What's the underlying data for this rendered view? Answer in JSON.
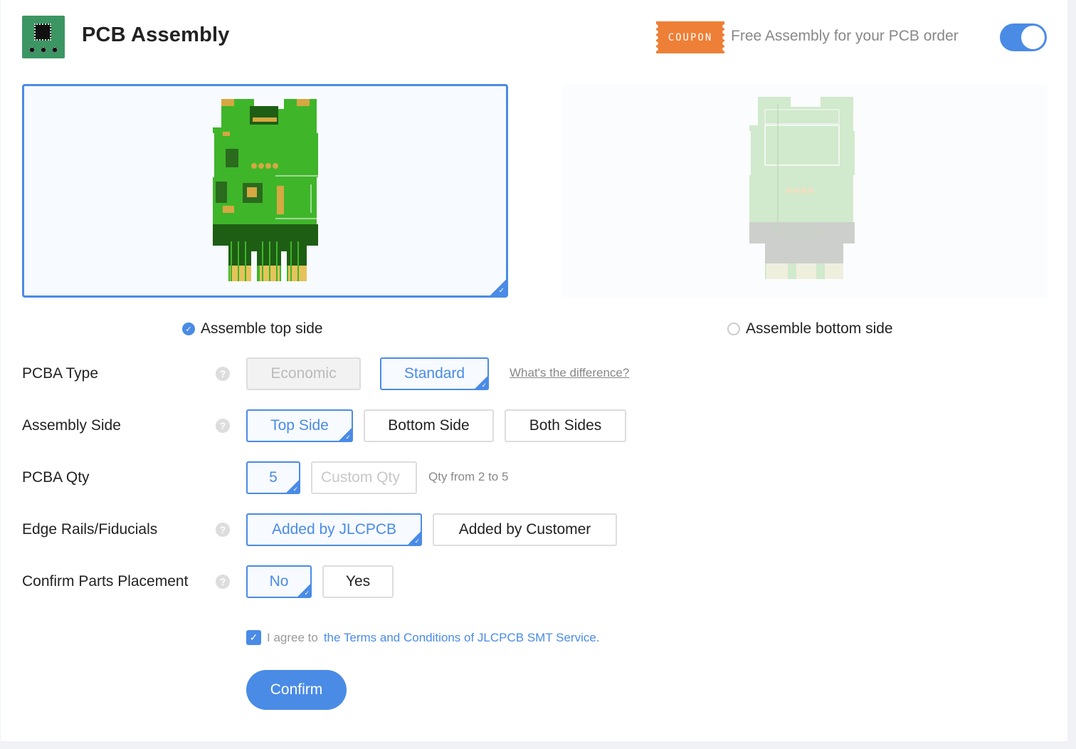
{
  "header": {
    "title": "PCB Assembly",
    "coupon_badge": "coupon",
    "coupon_text": "Free Assembly for your PCB order",
    "free_assembly_toggle_on": true
  },
  "preview": {
    "top_side_label": "Assemble top side",
    "bottom_side_label": "Assemble bottom side",
    "selected": "top"
  },
  "form": {
    "pcba_type": {
      "label": "PCBA Type",
      "options": [
        "Economic",
        "Standard"
      ],
      "selected": "Standard",
      "disabled": [
        "Economic"
      ],
      "link": "What's the difference?"
    },
    "assembly_side": {
      "label": "Assembly Side",
      "options": [
        "Top Side",
        "Bottom Side",
        "Both Sides"
      ],
      "selected": "Top Side"
    },
    "pcba_qty": {
      "label": "PCBA Qty",
      "value": "5",
      "custom_placeholder": "Custom Qty",
      "hint": "Qty from 2 to 5"
    },
    "edge_rails": {
      "label": "Edge Rails/Fiducials",
      "options": [
        "Added by JLCPCB",
        "Added by Customer"
      ],
      "selected": "Added by JLCPCB"
    },
    "confirm_placement": {
      "label": "Confirm Parts Placement",
      "options": [
        "No",
        "Yes"
      ],
      "selected": "No"
    }
  },
  "agreement": {
    "checked": true,
    "prefix": "I agree to",
    "link_text": "the Terms and Conditions of JLCPCB SMT Service."
  },
  "confirm_label": "Confirm",
  "icons": {
    "help": "?",
    "check": "✓"
  },
  "colors": {
    "accent": "#4a8be6",
    "coupon": "#ee7f36",
    "pcb_green": "#3fb52a",
    "logo_green": "#3c9663"
  }
}
